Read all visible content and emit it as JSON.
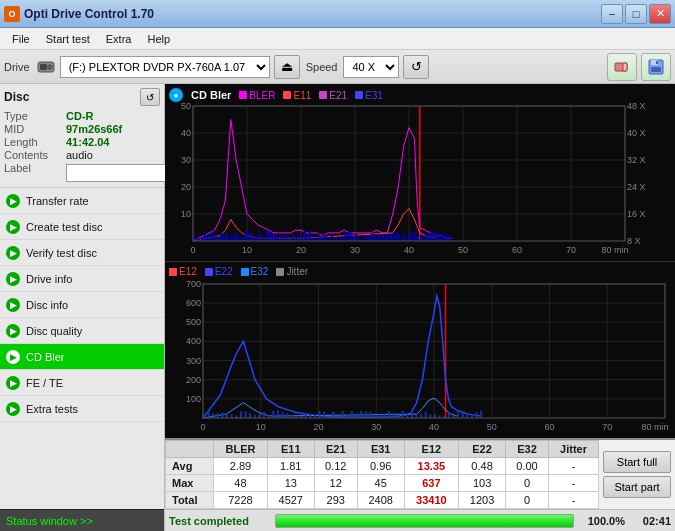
{
  "titlebar": {
    "icon": "O",
    "title": "Opti Drive Control 1.70",
    "min": "−",
    "max": "□",
    "close": "✕"
  },
  "menu": {
    "items": [
      "File",
      "Start test",
      "Extra",
      "Help"
    ]
  },
  "toolbar": {
    "drive_label": "Drive",
    "drive_value": "(F:)  PLEXTOR DVDR  PX-760A 1.07",
    "speed_label": "Speed",
    "speed_value": "40 X",
    "eject_icon": "⏏",
    "refresh_icon": "↺",
    "eraser_icon": "⌫",
    "save_icon": "💾"
  },
  "disc": {
    "title": "Disc",
    "type_key": "Type",
    "type_val": "CD-R",
    "mid_key": "MID",
    "mid_val": "97m26s66f",
    "length_key": "Length",
    "length_val": "41:42.04",
    "contents_key": "Contents",
    "contents_val": "audio",
    "label_key": "Label",
    "label_val": ""
  },
  "nav": {
    "items": [
      {
        "id": "transfer-rate",
        "label": "Transfer rate",
        "active": false
      },
      {
        "id": "create-test-disc",
        "label": "Create test disc",
        "active": false
      },
      {
        "id": "verify-test-disc",
        "label": "Verify test disc",
        "active": false
      },
      {
        "id": "drive-info",
        "label": "Drive info",
        "active": false
      },
      {
        "id": "disc-info",
        "label": "Disc info",
        "active": false
      },
      {
        "id": "disc-quality",
        "label": "Disc quality",
        "active": false
      },
      {
        "id": "cd-bler",
        "label": "CD Bler",
        "active": true
      },
      {
        "id": "fe-te",
        "label": "FE / TE",
        "active": false
      },
      {
        "id": "extra-tests",
        "label": "Extra tests",
        "active": false
      }
    ]
  },
  "status_window": {
    "label": "Status window >>",
    "bottom_status": "Test completed"
  },
  "chart1": {
    "title": "CD Bler",
    "legend": [
      {
        "label": "BLER",
        "color": "#ff00ff"
      },
      {
        "label": "E11",
        "color": "#ff4444"
      },
      {
        "label": "E21",
        "color": "#cc44cc"
      },
      {
        "label": "E31",
        "color": "#4444ff"
      }
    ],
    "y_labels": [
      "50",
      "40",
      "30",
      "20",
      "10"
    ],
    "x_labels": [
      "0",
      "10",
      "20",
      "30",
      "40",
      "50",
      "60",
      "70",
      "80 min"
    ],
    "right_labels": [
      "48 X",
      "40 X",
      "32 X",
      "24 X",
      "16 X",
      "8 X"
    ]
  },
  "chart2": {
    "legend": [
      {
        "label": "E12",
        "color": "#ff4444"
      },
      {
        "label": "E22",
        "color": "#4444ff"
      },
      {
        "label": "E32",
        "color": "#2288ff"
      },
      {
        "label": "Jitter",
        "color": "#888888"
      }
    ],
    "y_labels": [
      "700",
      "600",
      "500",
      "400",
      "300",
      "200",
      "100"
    ],
    "x_labels": [
      "0",
      "10",
      "20",
      "30",
      "40",
      "50",
      "60",
      "70",
      "80 min"
    ]
  },
  "data_table": {
    "columns": [
      "",
      "BLER",
      "E11",
      "E21",
      "E31",
      "E12",
      "E22",
      "E32",
      "Jitter"
    ],
    "rows": [
      {
        "label": "Avg",
        "values": [
          "2.89",
          "1.81",
          "0.12",
          "0.96",
          "13.35",
          "0.48",
          "0.00",
          "-"
        ]
      },
      {
        "label": "Max",
        "values": [
          "48",
          "13",
          "12",
          "45",
          "637",
          "103",
          "0",
          "-"
        ]
      },
      {
        "label": "Total",
        "values": [
          "7228",
          "4527",
          "293",
          "2408",
          "33410",
          "1203",
          "0",
          "-"
        ]
      }
    ],
    "btn_full": "Start full",
    "btn_part": "Start part"
  },
  "progress": {
    "status": "Test completed",
    "percent": "100.0%",
    "time": "02:41"
  }
}
